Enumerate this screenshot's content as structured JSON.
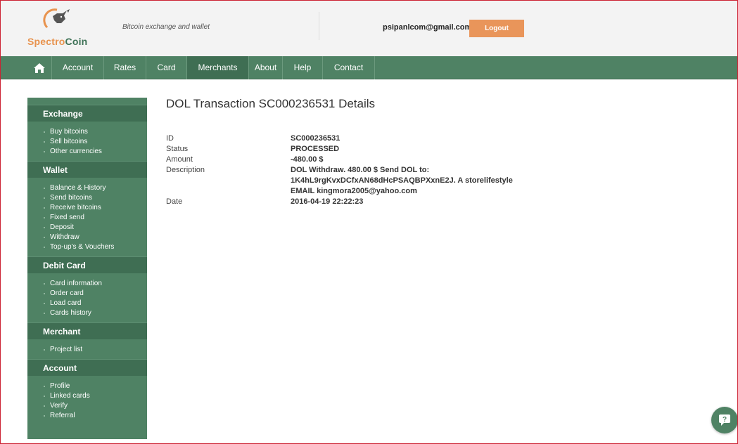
{
  "brand": {
    "name_part1": "Spectro",
    "name_part2": "Coin",
    "tagline": "Bitcoin exchange and wallet",
    "logo_color": "#e8934e",
    "accent_color": "#4f8264"
  },
  "header": {
    "email": "psipanlcom@gmail.com",
    "logout_label": "Logout"
  },
  "nav": {
    "home_icon": "home-icon",
    "items": [
      "Account",
      "Rates",
      "Card",
      "Merchants",
      "About",
      "Help",
      "Contact"
    ],
    "active": "Merchants"
  },
  "sidebar": {
    "sections": [
      {
        "title": "Exchange",
        "items": [
          "Buy bitcoins",
          "Sell bitcoins",
          "Other currencies"
        ]
      },
      {
        "title": "Wallet",
        "items": [
          "Balance & History",
          "Send bitcoins",
          "Receive bitcoins",
          "Fixed send",
          "Deposit",
          "Withdraw",
          "Top-up's & Vouchers"
        ]
      },
      {
        "title": "Debit Card",
        "items": [
          "Card information",
          "Order card",
          "Load card",
          "Cards history"
        ]
      },
      {
        "title": "Merchant",
        "items": [
          "Project list"
        ]
      },
      {
        "title": "Account",
        "items": [
          "Profile",
          "Linked cards",
          "Verify",
          "Referral"
        ]
      }
    ]
  },
  "main": {
    "title": "DOL Transaction SC000236531 Details",
    "details": [
      {
        "label": "ID",
        "value": "SC000236531"
      },
      {
        "label": "Status",
        "value": "PROCESSED"
      },
      {
        "label": "Amount",
        "value": "-480.00 $"
      },
      {
        "label": "Description",
        "value": "DOL Withdraw. 480.00 $ Send DOL to:",
        "value2": "1K4hL9rgKvxDCfxAN68dHcPSAQBPXxnE2J. A storelifestyle",
        "value3": "EMAIL kingmora2005@yahoo.com"
      },
      {
        "label": "Date",
        "value": "2016-04-19 22:22:23"
      }
    ]
  },
  "chat": {
    "icon": "chat-help-icon"
  }
}
